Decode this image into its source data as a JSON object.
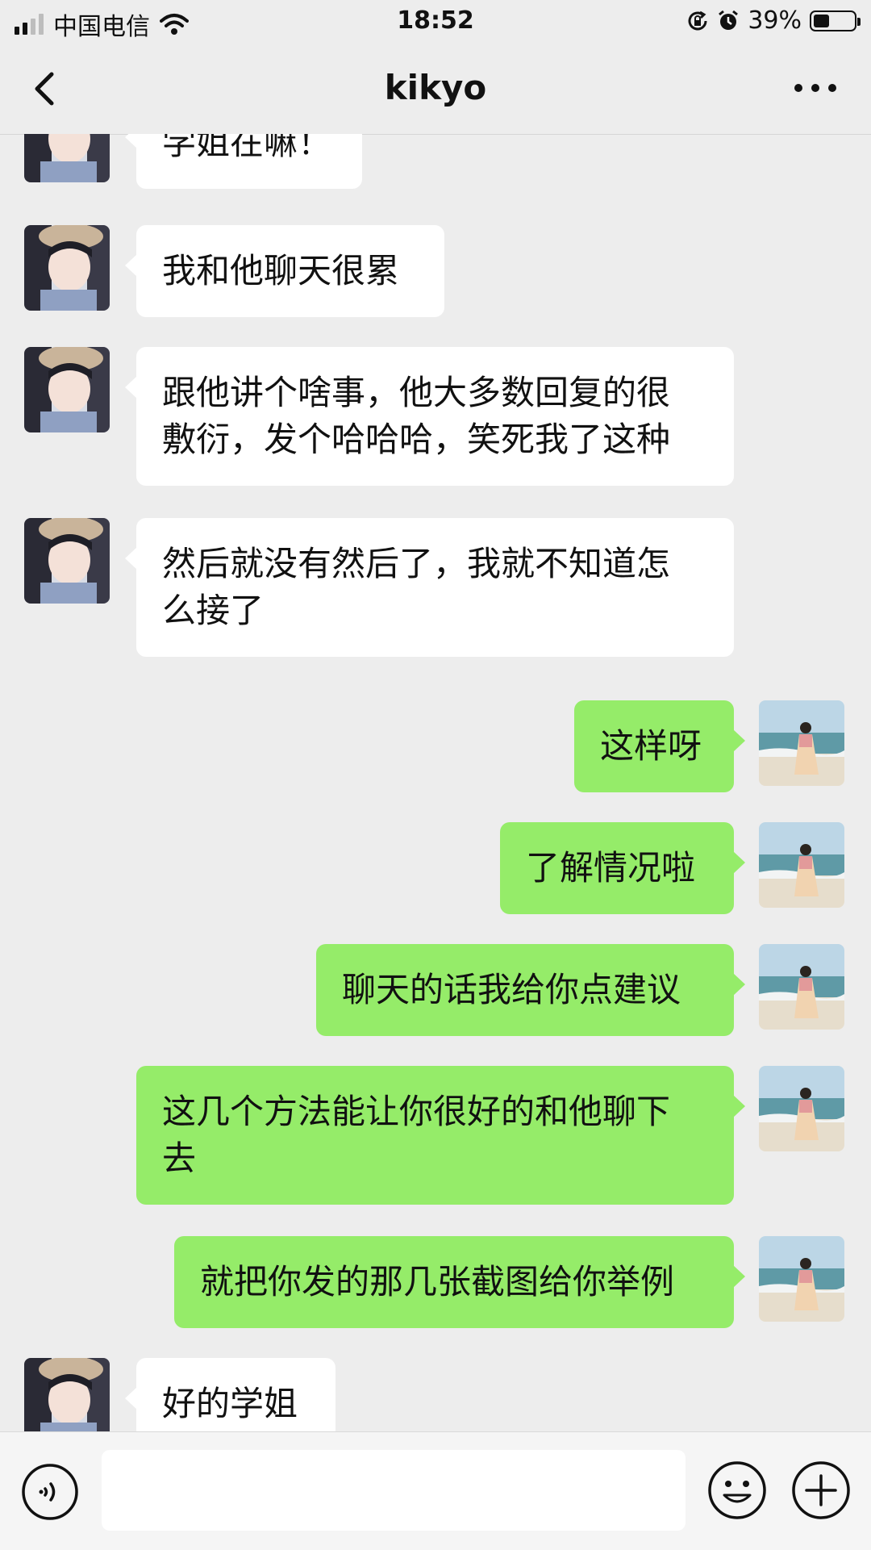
{
  "status_bar": {
    "carrier": "中国电信",
    "time": "18:52",
    "battery": "39%",
    "battery_level": 0.39,
    "icons": [
      "signal-icon",
      "wifi-icon",
      "rotation-lock-icon",
      "alarm-icon",
      "battery-icon"
    ]
  },
  "header": {
    "title": "kikyo",
    "back_icon": "back-chevron-icon",
    "more_icon": "more-dots-icon"
  },
  "messages": [
    {
      "side": "left",
      "text": "学姐在嘛！"
    },
    {
      "side": "left",
      "text": "我和他聊天很累"
    },
    {
      "side": "left",
      "text": "跟他讲个啥事，他大多数回复的很\n敷衍，发个哈哈哈，笑死我了这种"
    },
    {
      "side": "left",
      "text": "然后就没有然后了，我就不知道怎\n么接了"
    },
    {
      "side": "right",
      "text": "这样呀"
    },
    {
      "side": "right",
      "text": "了解情况啦"
    },
    {
      "side": "right",
      "text": "聊天的话我给你点建议"
    },
    {
      "side": "right",
      "text": "这几个方法能让你很好的和他聊下\n去"
    },
    {
      "side": "right",
      "text": "就把你发的那几张截图给你举例"
    },
    {
      "side": "left",
      "text": "好的学姐"
    }
  ],
  "input_bar": {
    "value": "",
    "icons": [
      "voice-icon",
      "emoji-icon",
      "add-icon"
    ]
  },
  "colors": {
    "background": "#ededed",
    "outgoing_bubble": "#95ec69",
    "incoming_bubble": "#ffffff"
  }
}
